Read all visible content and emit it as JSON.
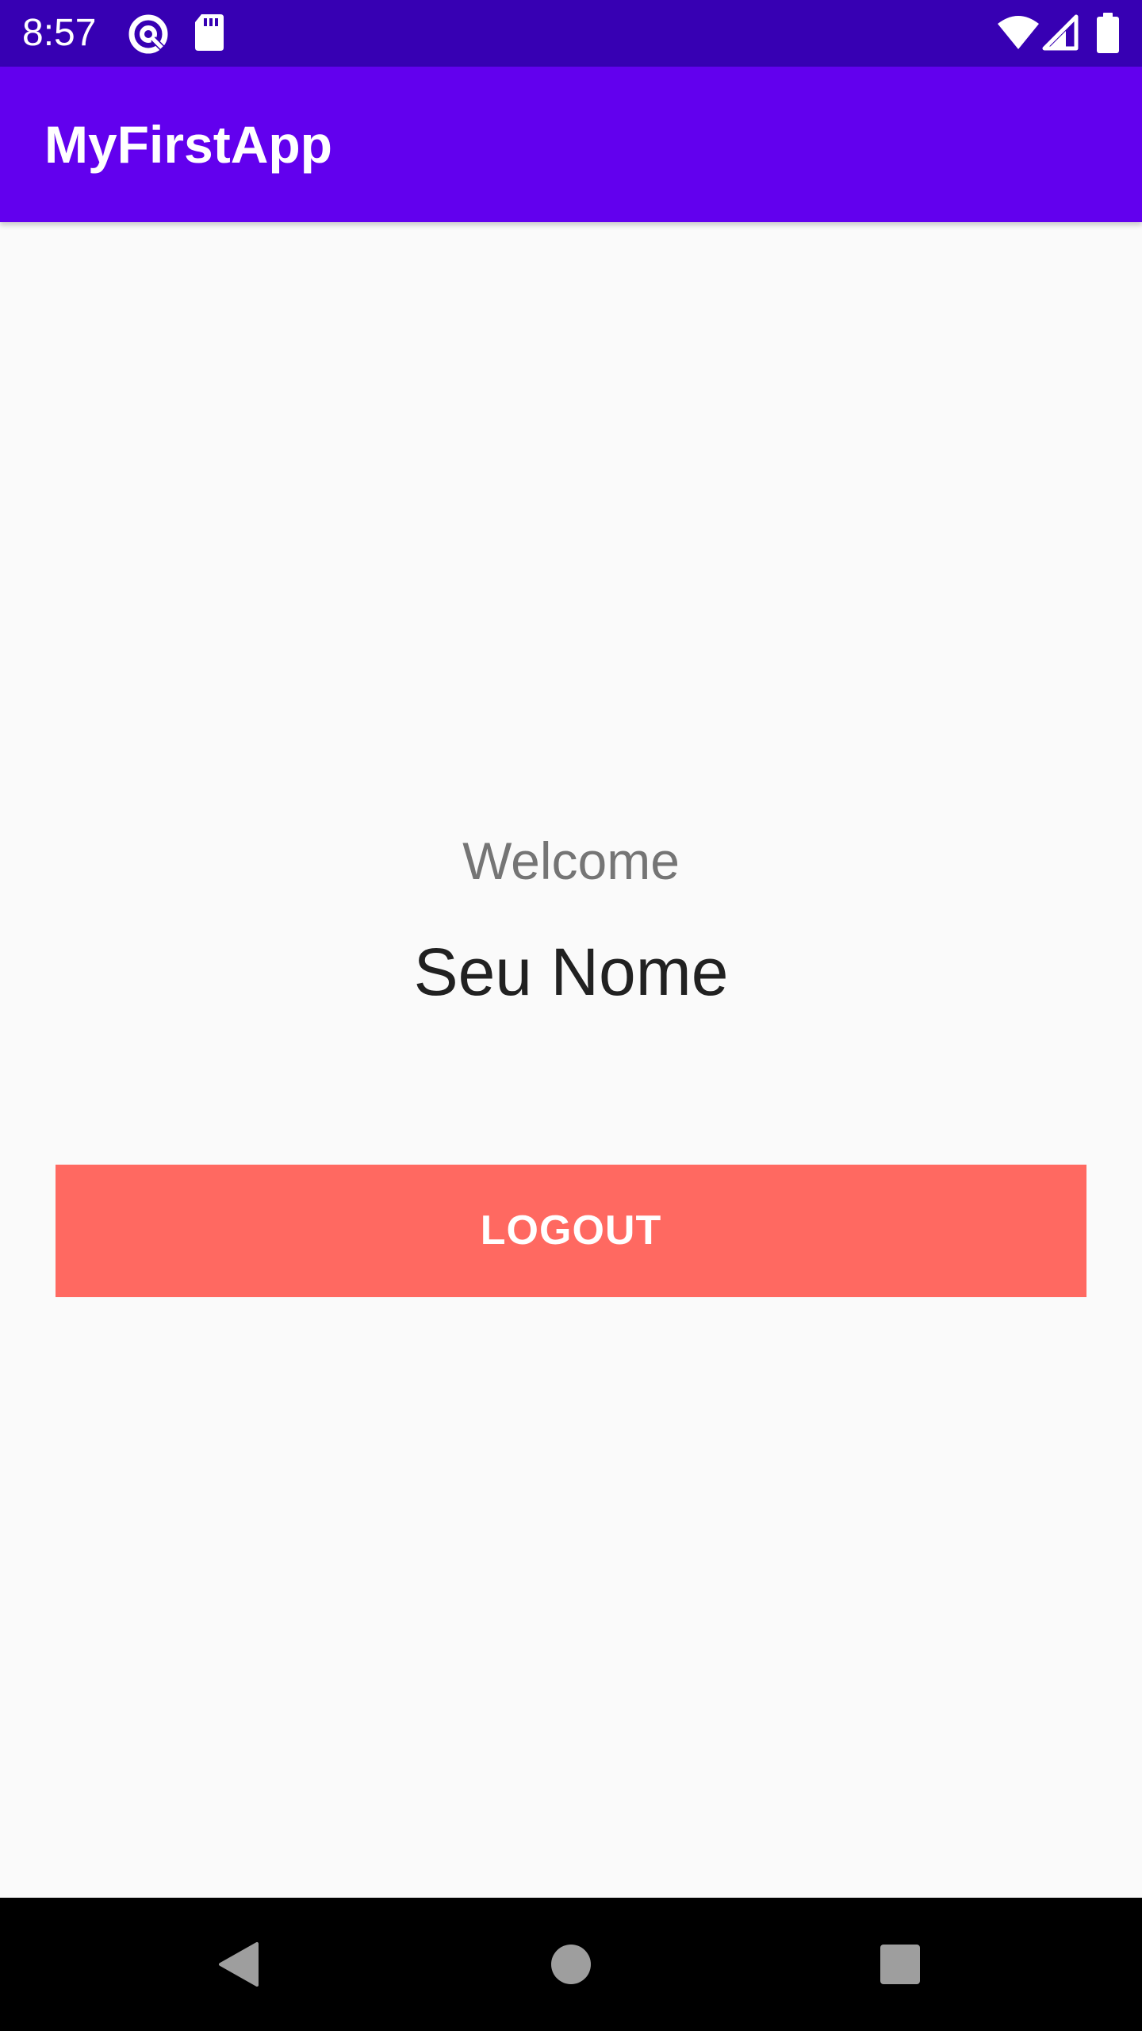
{
  "status_bar": {
    "time": "8:57",
    "background": "#3700b3",
    "icons": [
      "data-saver-icon",
      "sd-card-icon",
      "wifi-icon",
      "cell-signal-icon",
      "battery-icon"
    ]
  },
  "app_bar": {
    "title": "MyFirstApp",
    "background": "#6200ee"
  },
  "main": {
    "welcome_label": "Welcome",
    "user_name": "Seu Nome",
    "logout_label": "LOGOUT",
    "logout_color": "#ff6961"
  },
  "nav_bar": {
    "icons": [
      "back-icon",
      "home-icon",
      "recents-icon"
    ]
  }
}
